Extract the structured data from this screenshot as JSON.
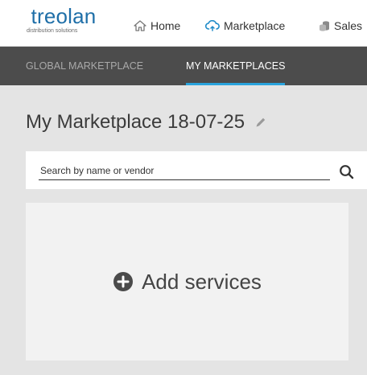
{
  "brand": {
    "name": "treolan",
    "tagline": "distribution solutions",
    "color": "#1f6fa8"
  },
  "topnav": {
    "items": [
      {
        "label": "Home",
        "icon": "home-icon"
      },
      {
        "label": "Marketplace",
        "icon": "cloud-icon"
      },
      {
        "label": "Sales",
        "icon": "coins-icon"
      }
    ]
  },
  "tabs": [
    {
      "label": "GLOBAL MARKETPLACE",
      "active": false
    },
    {
      "label": "MY MARKETPLACES",
      "active": true
    }
  ],
  "accent_color": "#2aa3dc",
  "page": {
    "title": "My Marketplace 18-07-25"
  },
  "search": {
    "placeholder": "Search by name or vendor",
    "value": ""
  },
  "add_card": {
    "label": "Add services",
    "icon": "plus-circle-icon"
  }
}
